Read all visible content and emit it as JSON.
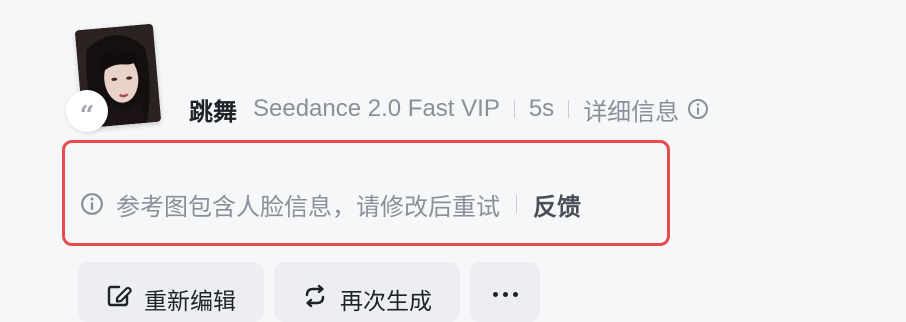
{
  "reference": {
    "quote_mark": "“"
  },
  "meta": {
    "title": "跳舞",
    "model": "Seedance 2.0 Fast VIP",
    "duration": "5s",
    "detail_label": "详细信息"
  },
  "notice": {
    "message": "参考图包含人脸信息，请修改后重试",
    "feedback_label": "反馈",
    "highlight_color": "#e84a4f"
  },
  "actions": {
    "edit_label": "重新编辑",
    "regenerate_label": "再次生成",
    "more_icon": "ellipsis-icon"
  }
}
